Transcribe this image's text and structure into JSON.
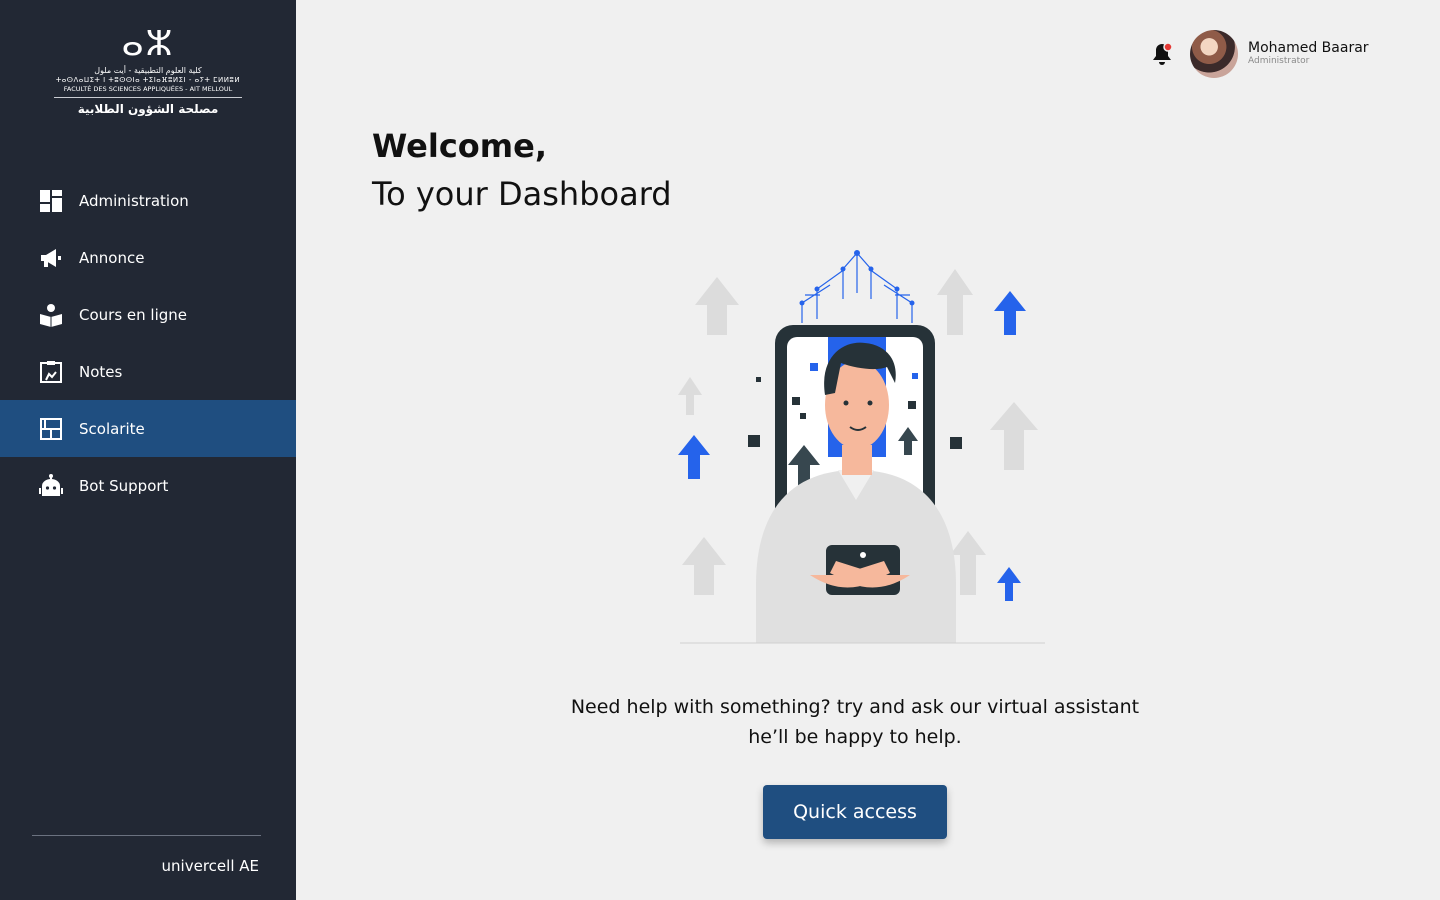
{
  "logo": {
    "line_arabic": "كلية العلوم التطبيقية - أيت ملول",
    "line_tifinagh": "ⵜⴰⵙⴷⴰⵡⵉⵜ ⵏ ⵜⵓⵙⵙⵏⴰ ⵜⵉⵏⴰⴼⵓⵍⵉⵏ - ⴰⵢⵜ ⵎⵍⵍⵓⵍ",
    "line_french": "FACULTÉ DES SCIENCES APPLIQUÉES - AIT MELLOUL",
    "line_service": "مصلحة الشؤون الطلابية"
  },
  "sidebar": {
    "items": [
      {
        "label": "Administration",
        "icon": "dashboard-icon",
        "active": false
      },
      {
        "label": "Annonce",
        "icon": "megaphone-icon",
        "active": false
      },
      {
        "label": "Cours en ligne",
        "icon": "book-reader-icon",
        "active": false
      },
      {
        "label": "Notes",
        "icon": "clipboard-icon",
        "active": false
      },
      {
        "label": "Scolarite",
        "icon": "layout-icon",
        "active": true
      },
      {
        "label": "Bot Support",
        "icon": "robot-icon",
        "active": false
      }
    ],
    "footer_brand": "univercell AE"
  },
  "header": {
    "user_name": "Mohamed Baarar",
    "user_role": "Administrator",
    "notification_dot": true
  },
  "main": {
    "welcome_line1": "Welcome,",
    "welcome_line2": "To your Dashboard",
    "help_line1": "Need help with something? try and ask our virtual assistant",
    "help_line2": "he’ll be happy to help.",
    "quick_access_label": "Quick access"
  },
  "colors": {
    "sidebar_bg": "#222834",
    "accent": "#1f4e80",
    "illustration_blue": "#2563eb",
    "notification_dot": "#e53935"
  }
}
